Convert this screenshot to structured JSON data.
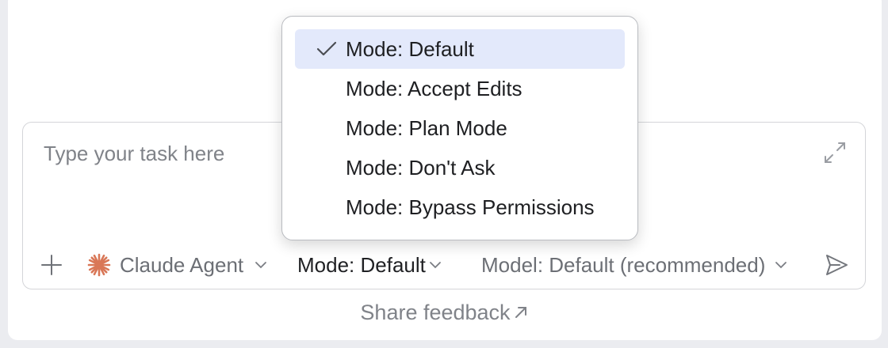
{
  "composer": {
    "placeholder": "Type your task here",
    "agent_label": "Claude Agent",
    "mode_label": "Mode: Default",
    "model_label": "Model: Default (recommended)"
  },
  "feedback_label": "Share feedback",
  "mode_menu": {
    "selected": "Mode: Default",
    "items": [
      {
        "label": "Mode: Default"
      },
      {
        "label": "Mode: Accept Edits"
      },
      {
        "label": "Mode: Plan Mode"
      },
      {
        "label": "Mode: Don't Ask"
      },
      {
        "label": "Mode: Bypass Permissions"
      }
    ]
  },
  "colors": {
    "accent_agent_icon": "#d97757",
    "selected_item_bg": "#e3e9fb"
  },
  "icons": [
    "expand-icon",
    "plus-icon",
    "claude-star-icon",
    "chevron-down-icon",
    "send-icon",
    "external-arrow-icon",
    "checkmark-icon"
  ]
}
